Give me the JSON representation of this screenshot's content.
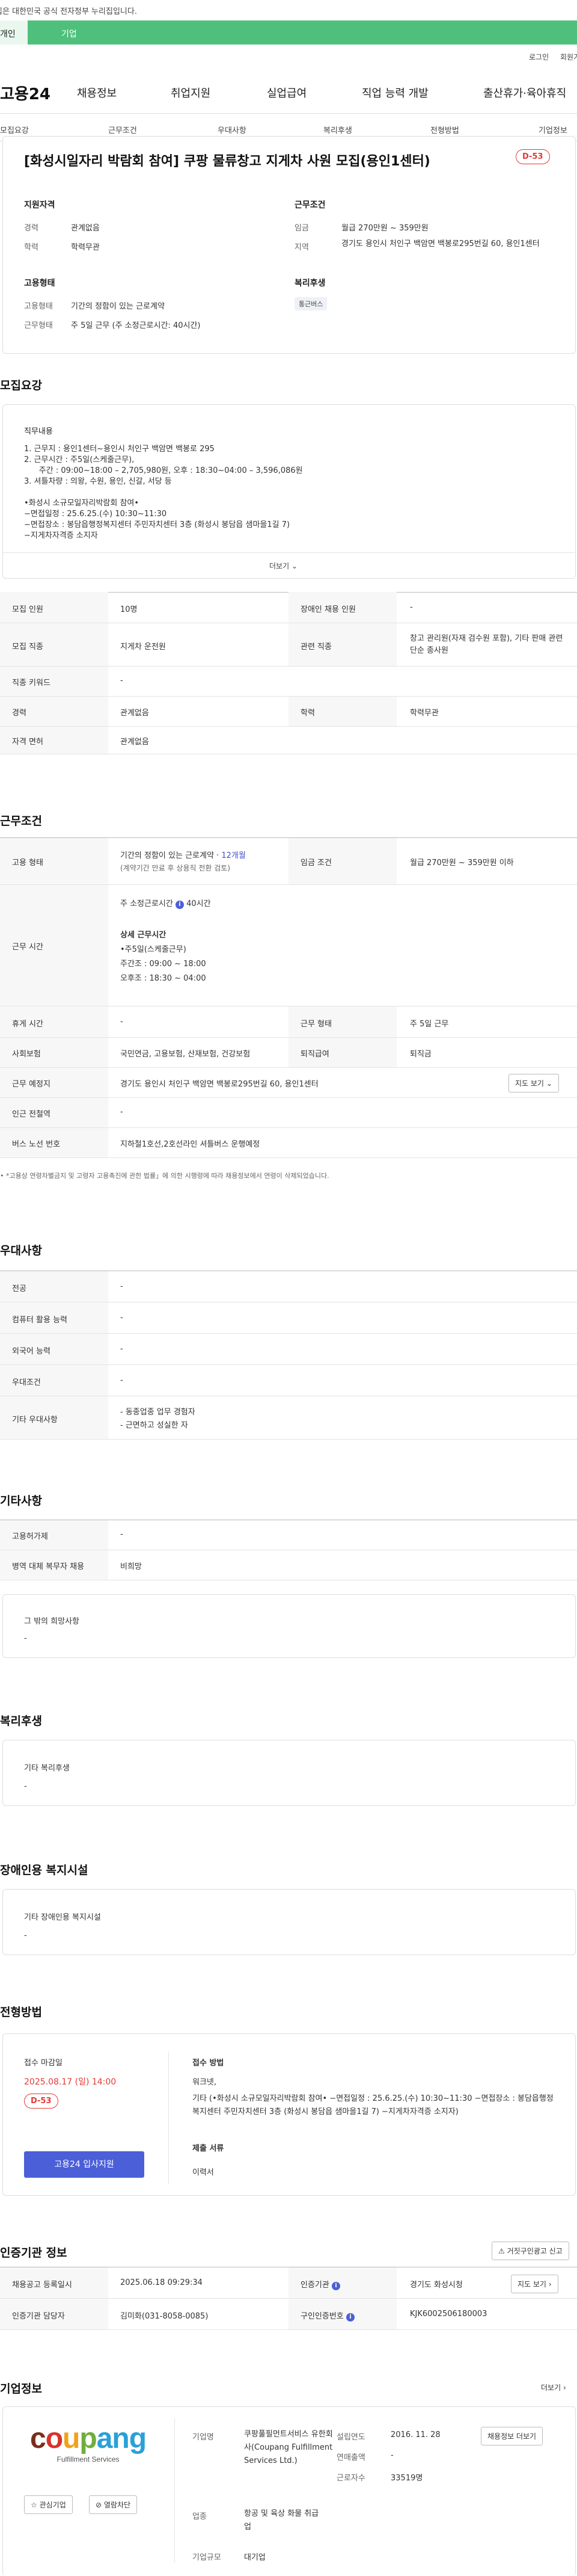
{
  "gov_banner": "이 누리집은 대한민국 공식 전자정부 누리집입니다.",
  "tabs": [
    "개인",
    "기업"
  ],
  "util": [
    "로그인",
    "회원가입"
  ],
  "logo": "고용24",
  "gnb": [
    "채용정보",
    "취업지원",
    "실업급여",
    "직업 능력 개발",
    "출산휴가·육아휴직"
  ],
  "lnb": [
    "모집요강",
    "근무조건",
    "우대사항",
    "복리후생",
    "전형방법",
    "기업정보"
  ],
  "title": "[화성시일자리 박람회 참여] 쿠팡 물류창고 지게차 사원 모집(용인1센터)",
  "dday": "D-53",
  "summary": {
    "support_title": "지원자격",
    "career_label": "경력",
    "career_value": "관계없음",
    "edu_label": "학력",
    "edu_value": "학력무관",
    "cond_title": "근무조건",
    "wage_label": "임금",
    "wage_value": "월급 270만원 ~ 359만원",
    "loc_label": "지역",
    "loc_value": "경기도 용인시 처인구 백암면 백봉로295번길 60, 용인1센터",
    "emp_title": "고용형태",
    "emp_label": "고용형태",
    "emp_value": "기간의 정함이 있는 근로계약",
    "work_label": "근무형태",
    "work_value": "주 5일 근무 (주 소정근로시간: 40시간)",
    "welfare_title": "복리후생",
    "welfare_chip": "통근버스"
  },
  "recruit": {
    "section": "모집요강",
    "job_title": "직무내용",
    "lines": [
      "1. 근무지 : 용인1센터~용인시 처인구 백암면 백봉로 295",
      "2. 근무시간 : 주5일(스케줄근무),",
      "      주간 : 09:00~18:00 – 2,705,980원, 오후 : 18:30~04:00 – 3,596,086원",
      "3. 셔틀차량 : 의왕, 수원, 용인, 신갈, 서당 등",
      "",
      "•화성시 소규모일자리박람회 참여•",
      "−면접일정 : 25.6.25.(수) 10:30~11:30",
      "−면접장소 : 봉담읍행정복지센터 주민자치센터 3층 (화성시 봉담읍 샘마을1길 7)",
      "−지게차자격증 소지자"
    ],
    "more": "더보기",
    "rows": [
      {
        "l1": "모집 인원",
        "v1": "10명",
        "l2": "장애인 채용 인원",
        "v2": "-"
      },
      {
        "l1": "모집 직종",
        "v1": "지게차 운전원",
        "l2": "관련 직종",
        "v2": "창고 관리원(자재 검수원 포함), 기타 판매 관련 단순 종사원"
      },
      {
        "l1": "직종 키워드",
        "v1": "-"
      },
      {
        "l1": "경력",
        "v1": "관계없음",
        "l2": "학력",
        "v2": "학력무관"
      },
      {
        "l1": "자격 면허",
        "v1": "관계없음"
      }
    ]
  },
  "conditions": {
    "section": "근무조건",
    "emp_label": "고용 형태",
    "emp_v1": "기간의 정함이 있는 근로계약 · ",
    "emp_months": "12개월",
    "emp_v2": "(계약기간 만료 후 상용직 전환 검토)",
    "wage_label": "임금 조건",
    "wage_value": "월급 270만원 ~ 359만원 이하",
    "hours_label": "근무 시간",
    "hours_head": "주 소정근로시간",
    "hours_hours": "40시간",
    "hours_detail_title": "상세 근무시간",
    "hours_detail": [
      "•주5일(스케줄근무)",
      "주간조 : 09:00 ~ 18:00",
      "오후조 : 18:30 ~ 04:00"
    ],
    "rest_label": "휴게 시간",
    "rest_value": "-",
    "type_label": "근무 형태",
    "type_value": "주 5일 근무",
    "ins_label": "사회보험",
    "ins_value": "국민연금, 고용보험, 산재보험, 건강보험",
    "ret_label": "퇴직급여",
    "ret_value": "퇴직금",
    "place_label": "근무 예정지",
    "place_value": "경기도 용인시 처인구 백암면 백봉로295번길 60, 용인1센터",
    "map_btn": "지도 보기",
    "subway_label": "인근 전철역",
    "subway_value": "-",
    "bus_label": "버스 노선 번호",
    "bus_value": "지하철1호선,2호선라인 셔틀버스 운행예정",
    "note": "• *고용상 연령차별금지 및 고령자 고용촉진에 관한 법률」에 의한 시행령에 따라 채용정보에서 연령이 삭제되었습니다."
  },
  "pref": {
    "section": "우대사항",
    "rows": [
      {
        "l": "전공",
        "v": "-"
      },
      {
        "l": "컴퓨터 활용 능력",
        "v": "-"
      },
      {
        "l": "외국어 능력",
        "v": "-"
      },
      {
        "l": "우대조건",
        "v": "-"
      }
    ],
    "etc_label": "기타 우대사항",
    "etc_values": [
      "- 동종업종 업무 경험자",
      "- 근면하고 성실한 자"
    ]
  },
  "other": {
    "section": "기타사항",
    "rows": [
      {
        "l": "고용허가제",
        "v": "-"
      },
      {
        "l": "병역 대체 복무자 채용",
        "v": "비희망"
      }
    ],
    "wish_title": "그 밖의 희망사항",
    "wish_value": "-"
  },
  "welfare": {
    "section": "복리후생",
    "label": "기타 복리후생",
    "value": "-"
  },
  "disabled": {
    "section": "장애인용 복지시설",
    "label": "기타 장애인용 복지시설",
    "value": "-"
  },
  "process": {
    "section": "전형방법",
    "deadline_label": "접수 마감일",
    "deadline": "2025.08.17 (일) 14:00",
    "dday": "D-53",
    "apply_btn": "고용24 입사지원",
    "method_label": "접수 방법",
    "method_value": "워크넷,",
    "method_etc": "기타 (•화성시 소규모일자리박람회 참여• −면접일정 : 25.6.25.(수) 10:30~11:30 −면접장소 : 봉담읍행정복지센터 주민자치센터 3층 (화성시 봉담읍 샘마을1길 7) −지게차자격증 소지자)",
    "docs_label": "제출 서류",
    "docs_value": "이력서"
  },
  "cert": {
    "section": "인증기관 정보",
    "report_btn": "거짓구인광고 신고",
    "reg_label": "채용공고 등록일시",
    "reg_value": "2025.06.18 09:29:34",
    "org_label": "인증기관",
    "org_value": "경기도 화성시청",
    "dir_btn": "지도 보기",
    "mgr_label": "인증기관 담당자",
    "mgr_value": "김미화(031-8058-0085)",
    "no_label": "구인인증번호",
    "no_value": "KJK6002506180003"
  },
  "company": {
    "section": "기업정보",
    "more": "더보기",
    "logo_text": "coupang",
    "logo_sub": "Fulfillment Services",
    "fav_btn": "관심기업",
    "block_btn": "열람차단",
    "name_label": "기업명",
    "name_value": "쿠팡풀필먼트서비스 유한회사(Coupang Fulfillment Services Ltd.)",
    "year_label": "설립연도",
    "year_value": "2016. 11. 28",
    "sales_label": "연매출액",
    "sales_value": "-",
    "emp_label": "근로자수",
    "emp_value": "33519명",
    "ind_label": "업종",
    "ind_value": "항공 및 육상 화물 취급업",
    "size_label": "기업규모",
    "size_value": "대기업",
    "list_btn": "채용정보 더보기"
  }
}
